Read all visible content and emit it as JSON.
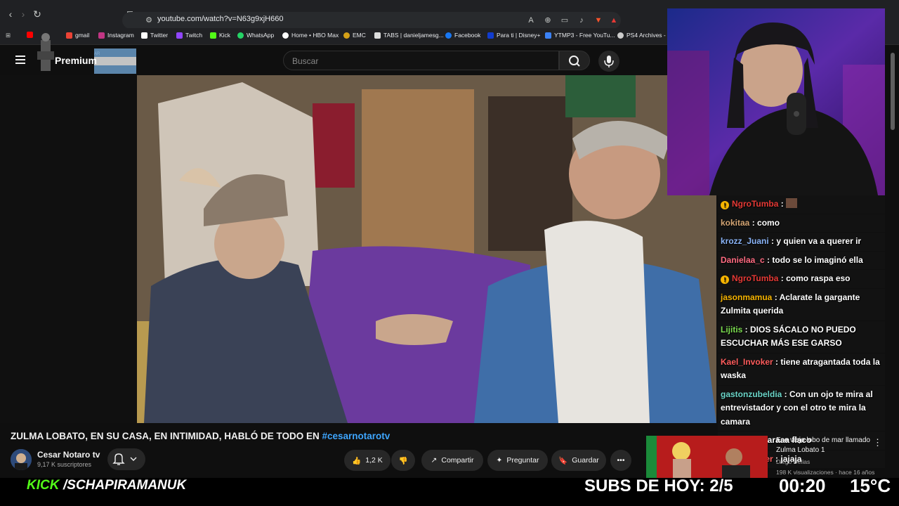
{
  "browser": {
    "url": "youtube.com/watch?v=N63g9xjH660",
    "bookmarks": [
      "gmail",
      "Instagram",
      "Twitter",
      "Twitch",
      "Kick",
      "WhatsApp",
      "Home • HBO Max",
      "EMC",
      "TABS | danieljamesg...",
      "Facebook",
      "Para ti | Disney+",
      "YTMP3 - Free YouTu...",
      "PS4 Archives - D"
    ]
  },
  "yt_header": {
    "logo": "Premium",
    "country": "AR",
    "search_placeholder": "Buscar"
  },
  "video": {
    "title_main": "ZULMA LOBATO, EN SU CASA, EN INTIMIDAD, HABLÓ DE TODO EN ",
    "title_tag": "#cesarnotarotv",
    "channel_name": "Cesar Notaro tv",
    "channel_subs": "9,17 K suscriptores",
    "likes": "1,2 K",
    "share_label": "Compartir",
    "ask_label": "Preguntar",
    "save_label": "Guardar"
  },
  "recommended": {
    "title": "Ese viejo lobo de mar llamado Zulma Lobato 1",
    "channel": "Diego Delias",
    "meta": "198 K visualizaciones · hace 16 años"
  },
  "chat": [
    {
      "user": "NgroTumba",
      "text": "",
      "color": "#e53935",
      "badge": true
    },
    {
      "user": "kokitaa",
      "text": "como",
      "color": "#d4a574",
      "badge": false
    },
    {
      "user": "krozz_Juani",
      "text": "y quien va a querer ir",
      "color": "#8ab4f8",
      "badge": false
    },
    {
      "user": "Danielaa_c",
      "text": "todo se lo imaginó ella",
      "color": "#ff6b81",
      "badge": false
    },
    {
      "user": "NgroTumba",
      "text": "como raspa eso",
      "color": "#e53935",
      "badge": true
    },
    {
      "user": "jasonmamua",
      "text": "Aclarate la gargante Zulmita querida",
      "color": "#f6b400",
      "badge": false
    },
    {
      "user": "Lijitis",
      "text": "DIOS SÁCALO NO PUEDO ESCUCHAR MÁS ESE GARSO",
      "color": "#7bdc4f",
      "badge": false
    },
    {
      "user": "Kael_Invoker",
      "text": "tiene atragantada toda la waska",
      "color": "#ff5c5c",
      "badge": false
    },
    {
      "user": "gastonzubeldia",
      "text": "Con un ojo te mira al entrevistador y con el otro te mira la camara",
      "color": "#6bd5c8",
      "badge": false
    },
    {
      "user": "Guiditus",
      "text": "paraaa flaco",
      "color": "#7bdc4f",
      "badge": false
    },
    {
      "user": "Kael_Invoker",
      "text": "jajaja",
      "color": "#ff5c5c",
      "badge": false
    }
  ],
  "overlay": {
    "kick": "KICK",
    "handle": "/SCHAPIRAMANUK",
    "subs": "SUBS DE HOY: 2/5",
    "clock": "00:20",
    "temp": "15°C"
  }
}
